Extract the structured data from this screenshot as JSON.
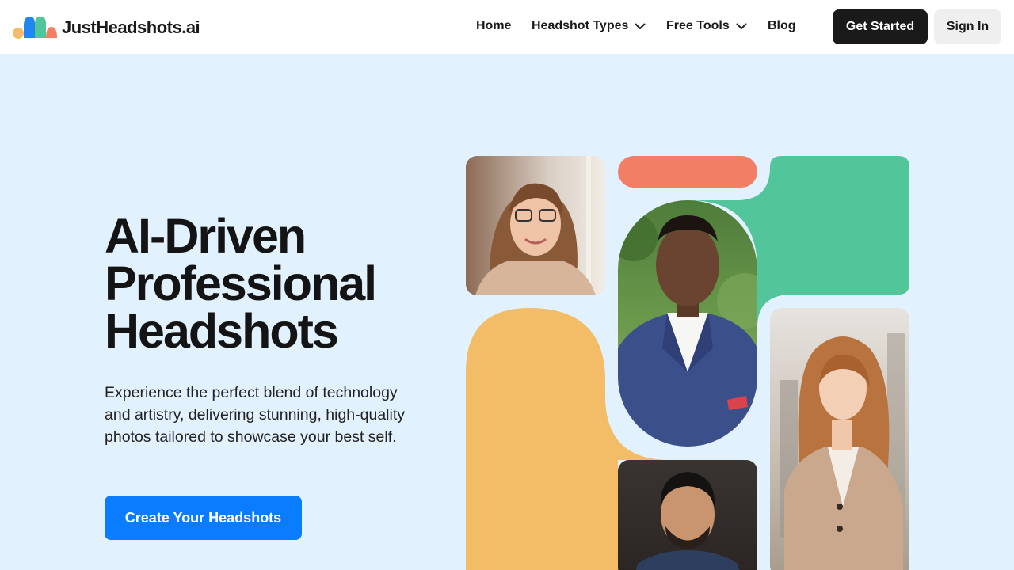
{
  "brand": {
    "name": "JustHeadshots.ai"
  },
  "nav": {
    "items": [
      {
        "label": "Home",
        "dropdown": false
      },
      {
        "label": "Headshot Types",
        "dropdown": true
      },
      {
        "label": "Free Tools",
        "dropdown": true
      },
      {
        "label": "Blog",
        "dropdown": false
      }
    ],
    "get_started": "Get Started",
    "sign_in": "Sign In"
  },
  "hero": {
    "title_lines": [
      "AI-Driven",
      "Professional",
      "Headshots"
    ],
    "subtitle": "Experience the perfect blend of technology and artistry, delivering stunning, high-quality photos tailored to showcase your best self.",
    "cta": "Create Your Headshots"
  },
  "colors": {
    "background": "#e2f1fe",
    "accent_blue": "#0a7cff",
    "coral": "#f27e66",
    "green": "#52c59a",
    "yellow": "#f2bd66",
    "dark": "#1a1a1a"
  },
  "collage": {
    "photos": [
      {
        "name": "woman-glasses-photo"
      },
      {
        "name": "man-blue-suit-photo"
      },
      {
        "name": "woman-beige-coat-photo"
      },
      {
        "name": "man-dark-jacket-photo"
      }
    ]
  }
}
